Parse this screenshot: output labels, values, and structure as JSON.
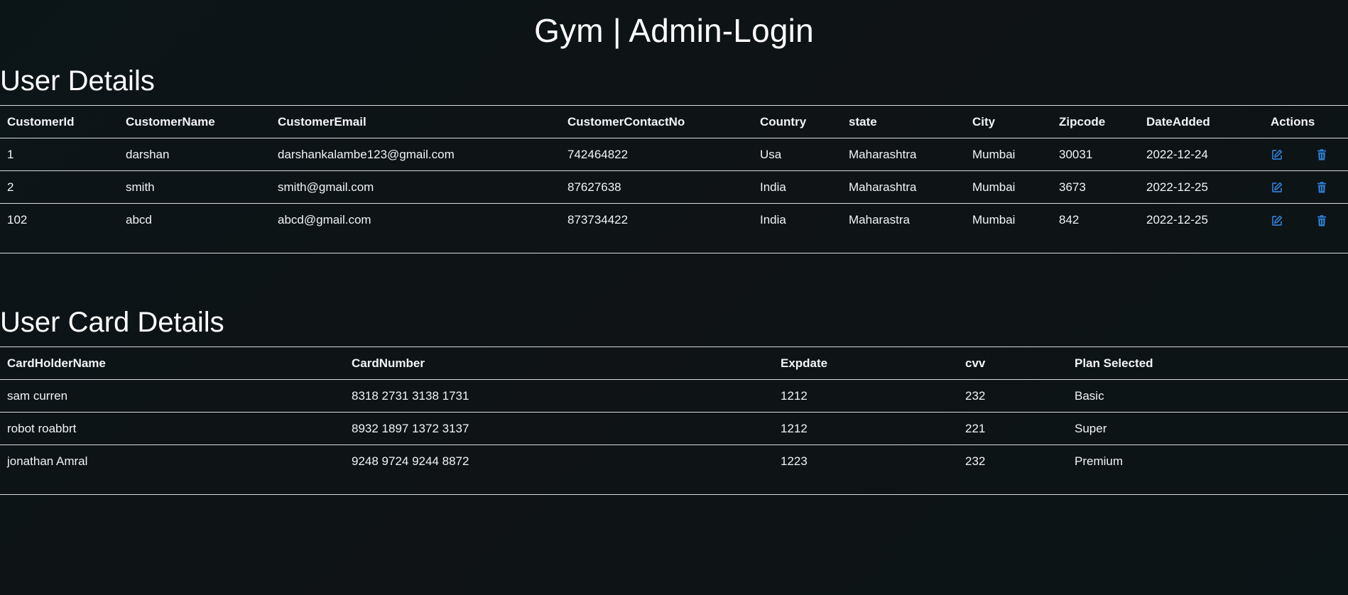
{
  "page": {
    "title": "Gym | Admin-Login"
  },
  "colors": {
    "background": "#0f1315",
    "text": "#f2f4f5",
    "icon_accent": "#2e7fd6",
    "row_divider": "#d9dde0"
  },
  "users": {
    "title": "User Details",
    "headers": [
      "CustomerId",
      "CustomerName",
      "CustomerEmail",
      "CustomerContactNo",
      "Country",
      "state",
      "City",
      "Zipcode",
      "DateAdded",
      "Actions"
    ],
    "rows": [
      {
        "id": "1",
        "name": "darshan",
        "email": "darshankalambe123@gmail.com",
        "contact": "742464822",
        "country": "Usa",
        "state": "Maharashtra",
        "city": "Mumbai",
        "zipcode": "30031",
        "date": "2022-12-24"
      },
      {
        "id": "2",
        "name": "smith",
        "email": "smith@gmail.com",
        "contact": "87627638",
        "country": "India",
        "state": "Maharashtra",
        "city": "Mumbai",
        "zipcode": "3673",
        "date": "2022-12-25"
      },
      {
        "id": "102",
        "name": "abcd",
        "email": "abcd@gmail.com",
        "contact": "873734422",
        "country": "India",
        "state": "Maharastra",
        "city": "Mumbai",
        "zipcode": "842",
        "date": "2022-12-25"
      }
    ],
    "action_icons": [
      "edit-icon",
      "trash-icon"
    ]
  },
  "cards": {
    "title": "User Card Details",
    "headers": [
      "CardHolderName",
      "CardNumber",
      "Expdate",
      "cvv",
      "Plan Selected"
    ],
    "rows": [
      {
        "holder": "sam curren",
        "number": "8318 2731 3138 1731",
        "exp": "1212",
        "cvv": "232",
        "plan": "Basic"
      },
      {
        "holder": "robot roabbrt",
        "number": "8932 1897 1372 3137",
        "exp": "1212",
        "cvv": "221",
        "plan": "Super"
      },
      {
        "holder": "jonathan Amral",
        "number": "9248 9724 9244 8872",
        "exp": "1223",
        "cvv": "232",
        "plan": "Premium"
      }
    ]
  }
}
